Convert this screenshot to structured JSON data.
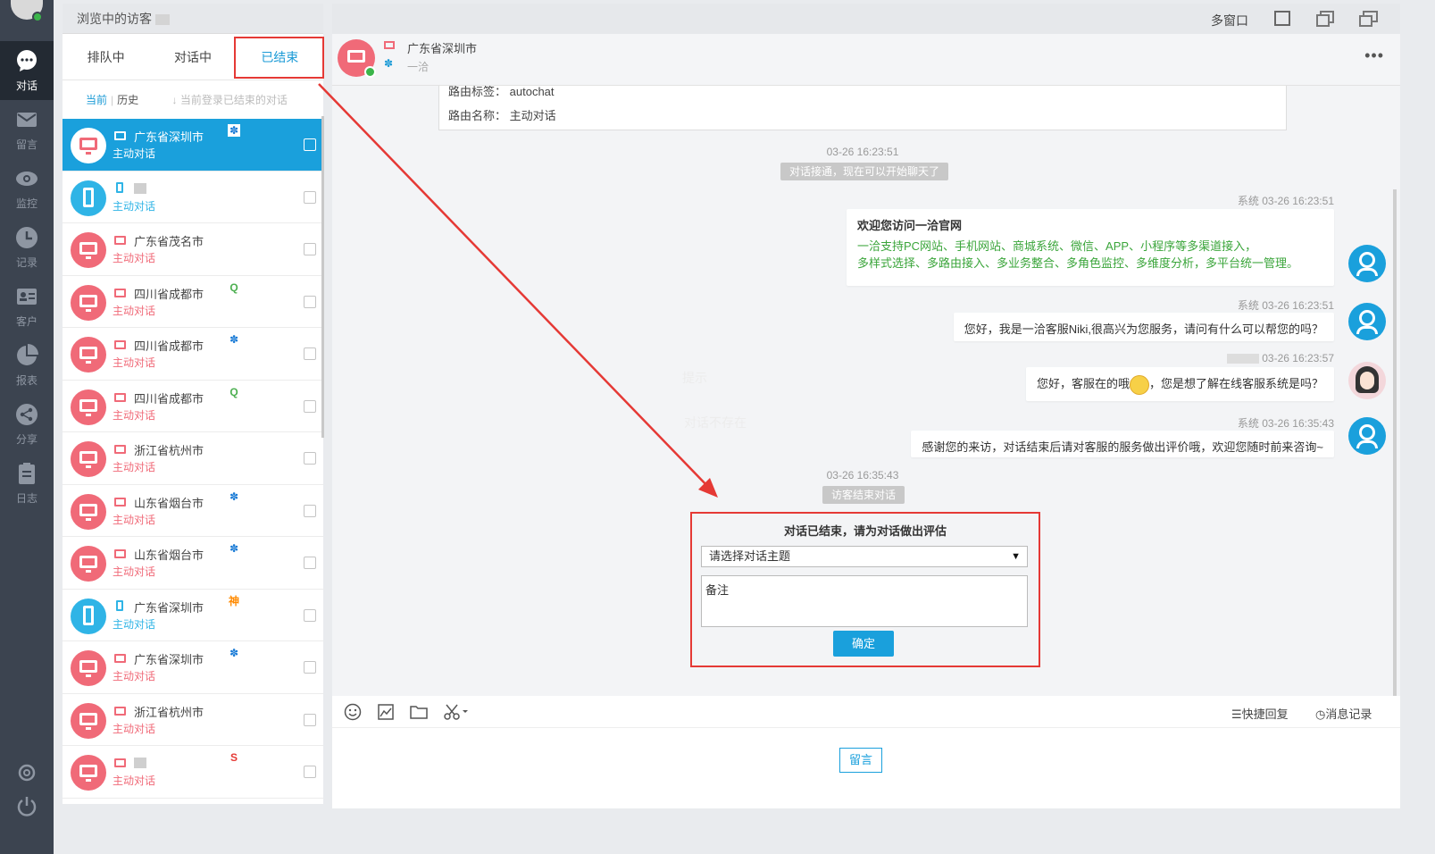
{
  "nav": {
    "items": [
      {
        "label": "对话",
        "icon": "chat-bubble-icon",
        "active": true
      },
      {
        "label": "留言",
        "icon": "mail-icon"
      },
      {
        "label": "监控",
        "icon": "eye-icon"
      },
      {
        "label": "记录",
        "icon": "clock-icon"
      },
      {
        "label": "客户",
        "icon": "id-card-icon"
      },
      {
        "label": "报表",
        "icon": "pie-chart-icon"
      },
      {
        "label": "分享",
        "icon": "share-icon"
      },
      {
        "label": "日志",
        "icon": "clipboard-icon"
      }
    ]
  },
  "visitors": {
    "header": "浏览中的访客",
    "tabs": [
      "排队中",
      "对话中",
      "已结束"
    ],
    "subtabs": {
      "current": "当前",
      "history": "历史",
      "hint": "当前登录已结束的对话"
    },
    "items": [
      {
        "name": "广东省深圳市",
        "sub": "主动对话",
        "device": "pc",
        "source": "baidu",
        "active": true
      },
      {
        "name": "",
        "sub": "主动对话",
        "device": "mobile",
        "source": ""
      },
      {
        "name": "广东省茂名市",
        "sub": "主动对话",
        "device": "pc",
        "source": ""
      },
      {
        "name": "四川省成都市",
        "sub": "主动对话",
        "device": "pc",
        "source": "360"
      },
      {
        "name": "四川省成都市",
        "sub": "主动对话",
        "device": "pc",
        "source": "baidu"
      },
      {
        "name": "四川省成都市",
        "sub": "主动对话",
        "device": "pc",
        "source": "360"
      },
      {
        "name": "浙江省杭州市",
        "sub": "主动对话",
        "device": "pc",
        "source": ""
      },
      {
        "name": "山东省烟台市",
        "sub": "主动对话",
        "device": "pc",
        "source": "baidu"
      },
      {
        "name": "山东省烟台市",
        "sub": "主动对话",
        "device": "pc",
        "source": "baidu"
      },
      {
        "name": "广东省深圳市",
        "sub": "主动对话",
        "device": "mobile",
        "source": "shenma"
      },
      {
        "name": "广东省深圳市",
        "sub": "主动对话",
        "device": "pc",
        "source": "baidu"
      },
      {
        "name": "浙江省杭州市",
        "sub": "主动对话",
        "device": "pc",
        "source": ""
      },
      {
        "name": "",
        "sub": "主动对话",
        "device": "pc",
        "source": "sogou"
      }
    ]
  },
  "topbar": {
    "multi_window": "多窗口"
  },
  "chat": {
    "title": "广东省深圳市",
    "subtitle": "一洽",
    "route_tag_label": "路由标签：",
    "route_tag_value": "autochat",
    "route_name_label": "路由名称：",
    "route_name_value": "主动对话",
    "ts1": "03-26 16:23:51",
    "sys1": "对话接通，现在可以开始聊天了",
    "msg1_meta": "系统  03-26 16:23:51",
    "msg1_title": "欢迎您访问一洽官网",
    "msg1_line1": "一洽支持PC网站、手机网站、商城系统、微信、APP、小程序等多渠道接入，",
    "msg1_line2": "多样式选择、多路由接入、多业务整合、多角色监控、多维度分析，多平台统一管理。",
    "msg2_meta": "系统  03-26 16:23:51",
    "msg2": "您好，我是一洽客服Niki,很高兴为您服务，请问有什么可以帮您的吗？",
    "msg3_meta": "03-26 16:23:57",
    "msg3_a": "您好，客服在的哦",
    "msg3_b": "，您是想了解在线客服系统是吗？",
    "msg4_meta": "系统  03-26 16:35:43",
    "msg4": "感谢您的来访，对话结束后请对客服的服务做出评价哦，欢迎您随时前来咨询~",
    "ts2": "03-26 16:35:43",
    "sys2": "访客结束对话",
    "ghost_title": "提示",
    "ghost_text": "对话不存在"
  },
  "evaluation": {
    "title": "对话已结束，请为对话做出评估",
    "select_placeholder": "请选择对话主题",
    "note_placeholder": "备注",
    "confirm": "确定"
  },
  "toolbar": {
    "quick_reply": "快捷回复",
    "message_history": "消息记录"
  },
  "composer": {
    "leave_message": "留言"
  },
  "colors": {
    "accent": "#1aa0dc",
    "pc_visitor": "#f06a78",
    "annotation": "#e53935",
    "nav_bg": "#3c4450"
  }
}
